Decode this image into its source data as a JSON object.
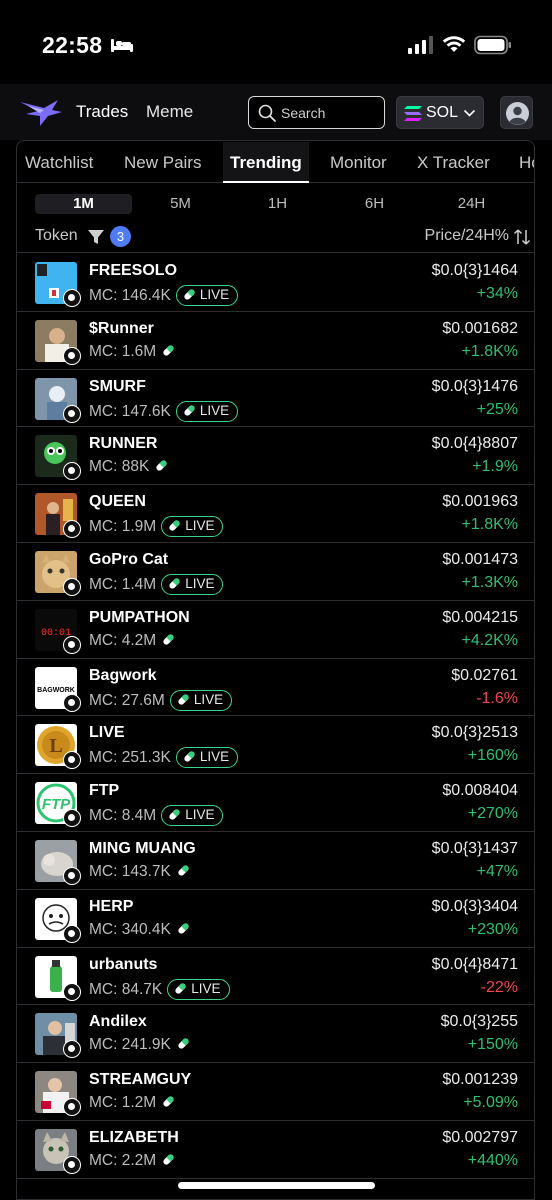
{
  "status": {
    "time": "22:58"
  },
  "header": {
    "nav": [
      "Trades",
      "Meme"
    ],
    "search_placeholder": "Search",
    "chain": "SOL",
    "colors": {
      "accent": "#4f7cf5",
      "up": "#2fbf71",
      "down": "#f0474f",
      "live_border": "#3ad68a"
    }
  },
  "tabs": [
    "Watchlist",
    "New Pairs",
    "Trending",
    "Monitor",
    "X Tracker",
    "Ho"
  ],
  "active_tab": "Trending",
  "timeframes": [
    "1M",
    "5M",
    "1H",
    "6H",
    "24H"
  ],
  "active_timeframe": "1M",
  "list_header": {
    "token": "Token",
    "filter_count": "3",
    "price": "Price/24H%"
  },
  "tokens": [
    {
      "name": "FREESOLO",
      "mc": "MC: 146.4K",
      "live": true,
      "price": "$0.0{3}1464",
      "change": "+34%",
      "dir": "up"
    },
    {
      "name": "$Runner",
      "mc": "MC: 1.6M",
      "live": false,
      "price": "$0.001682",
      "change": "+1.8K%",
      "dir": "up"
    },
    {
      "name": "SMURF",
      "mc": "MC: 147.6K",
      "live": true,
      "price": "$0.0{3}1476",
      "change": "+25%",
      "dir": "up"
    },
    {
      "name": "RUNNER",
      "mc": "MC: 88K",
      "live": false,
      "price": "$0.0{4}8807",
      "change": "+1.9%",
      "dir": "up"
    },
    {
      "name": "QUEEN",
      "mc": "MC: 1.9M",
      "live": true,
      "price": "$0.001963",
      "change": "+1.8K%",
      "dir": "up"
    },
    {
      "name": "GoPro Cat",
      "mc": "MC: 1.4M",
      "live": true,
      "price": "$0.001473",
      "change": "+1.3K%",
      "dir": "up"
    },
    {
      "name": "PUMPATHON",
      "mc": "MC: 4.2M",
      "live": false,
      "price": "$0.004215",
      "change": "+4.2K%",
      "dir": "up"
    },
    {
      "name": "Bagwork",
      "mc": "MC: 27.6M",
      "live": true,
      "price": "$0.02761",
      "change": "-1.6%",
      "dir": "down"
    },
    {
      "name": "LIVE",
      "mc": "MC: 251.3K",
      "live": true,
      "price": "$0.0{3}2513",
      "change": "+160%",
      "dir": "up"
    },
    {
      "name": "FTP",
      "mc": "MC: 8.4M",
      "live": true,
      "price": "$0.008404",
      "change": "+270%",
      "dir": "up"
    },
    {
      "name": "MING MUANG",
      "mc": "MC: 143.7K",
      "live": false,
      "price": "$0.0{3}1437",
      "change": "+47%",
      "dir": "up"
    },
    {
      "name": "HERP",
      "mc": "MC: 340.4K",
      "live": false,
      "price": "$0.0{3}3404",
      "change": "+230%",
      "dir": "up"
    },
    {
      "name": "urbanuts",
      "mc": "MC: 84.7K",
      "live": true,
      "price": "$0.0{4}8471",
      "change": "-22%",
      "dir": "down"
    },
    {
      "name": "Andilex",
      "mc": "MC: 241.9K",
      "live": false,
      "price": "$0.0{3}255",
      "change": "+150%",
      "dir": "up"
    },
    {
      "name": "STREAMGUY",
      "mc": "MC: 1.2M",
      "live": false,
      "price": "$0.001239",
      "change": "+5.09%",
      "dir": "up"
    },
    {
      "name": "ELIZABETH",
      "mc": "MC: 2.2M",
      "live": false,
      "price": "$0.002797",
      "change": "+440%",
      "dir": "up"
    }
  ],
  "live_label": "LIVE",
  "thumb_texts": {
    "PUMPATHON": "00:01",
    "Bagwork": "BAGWORK",
    "FTP": "FTP"
  }
}
